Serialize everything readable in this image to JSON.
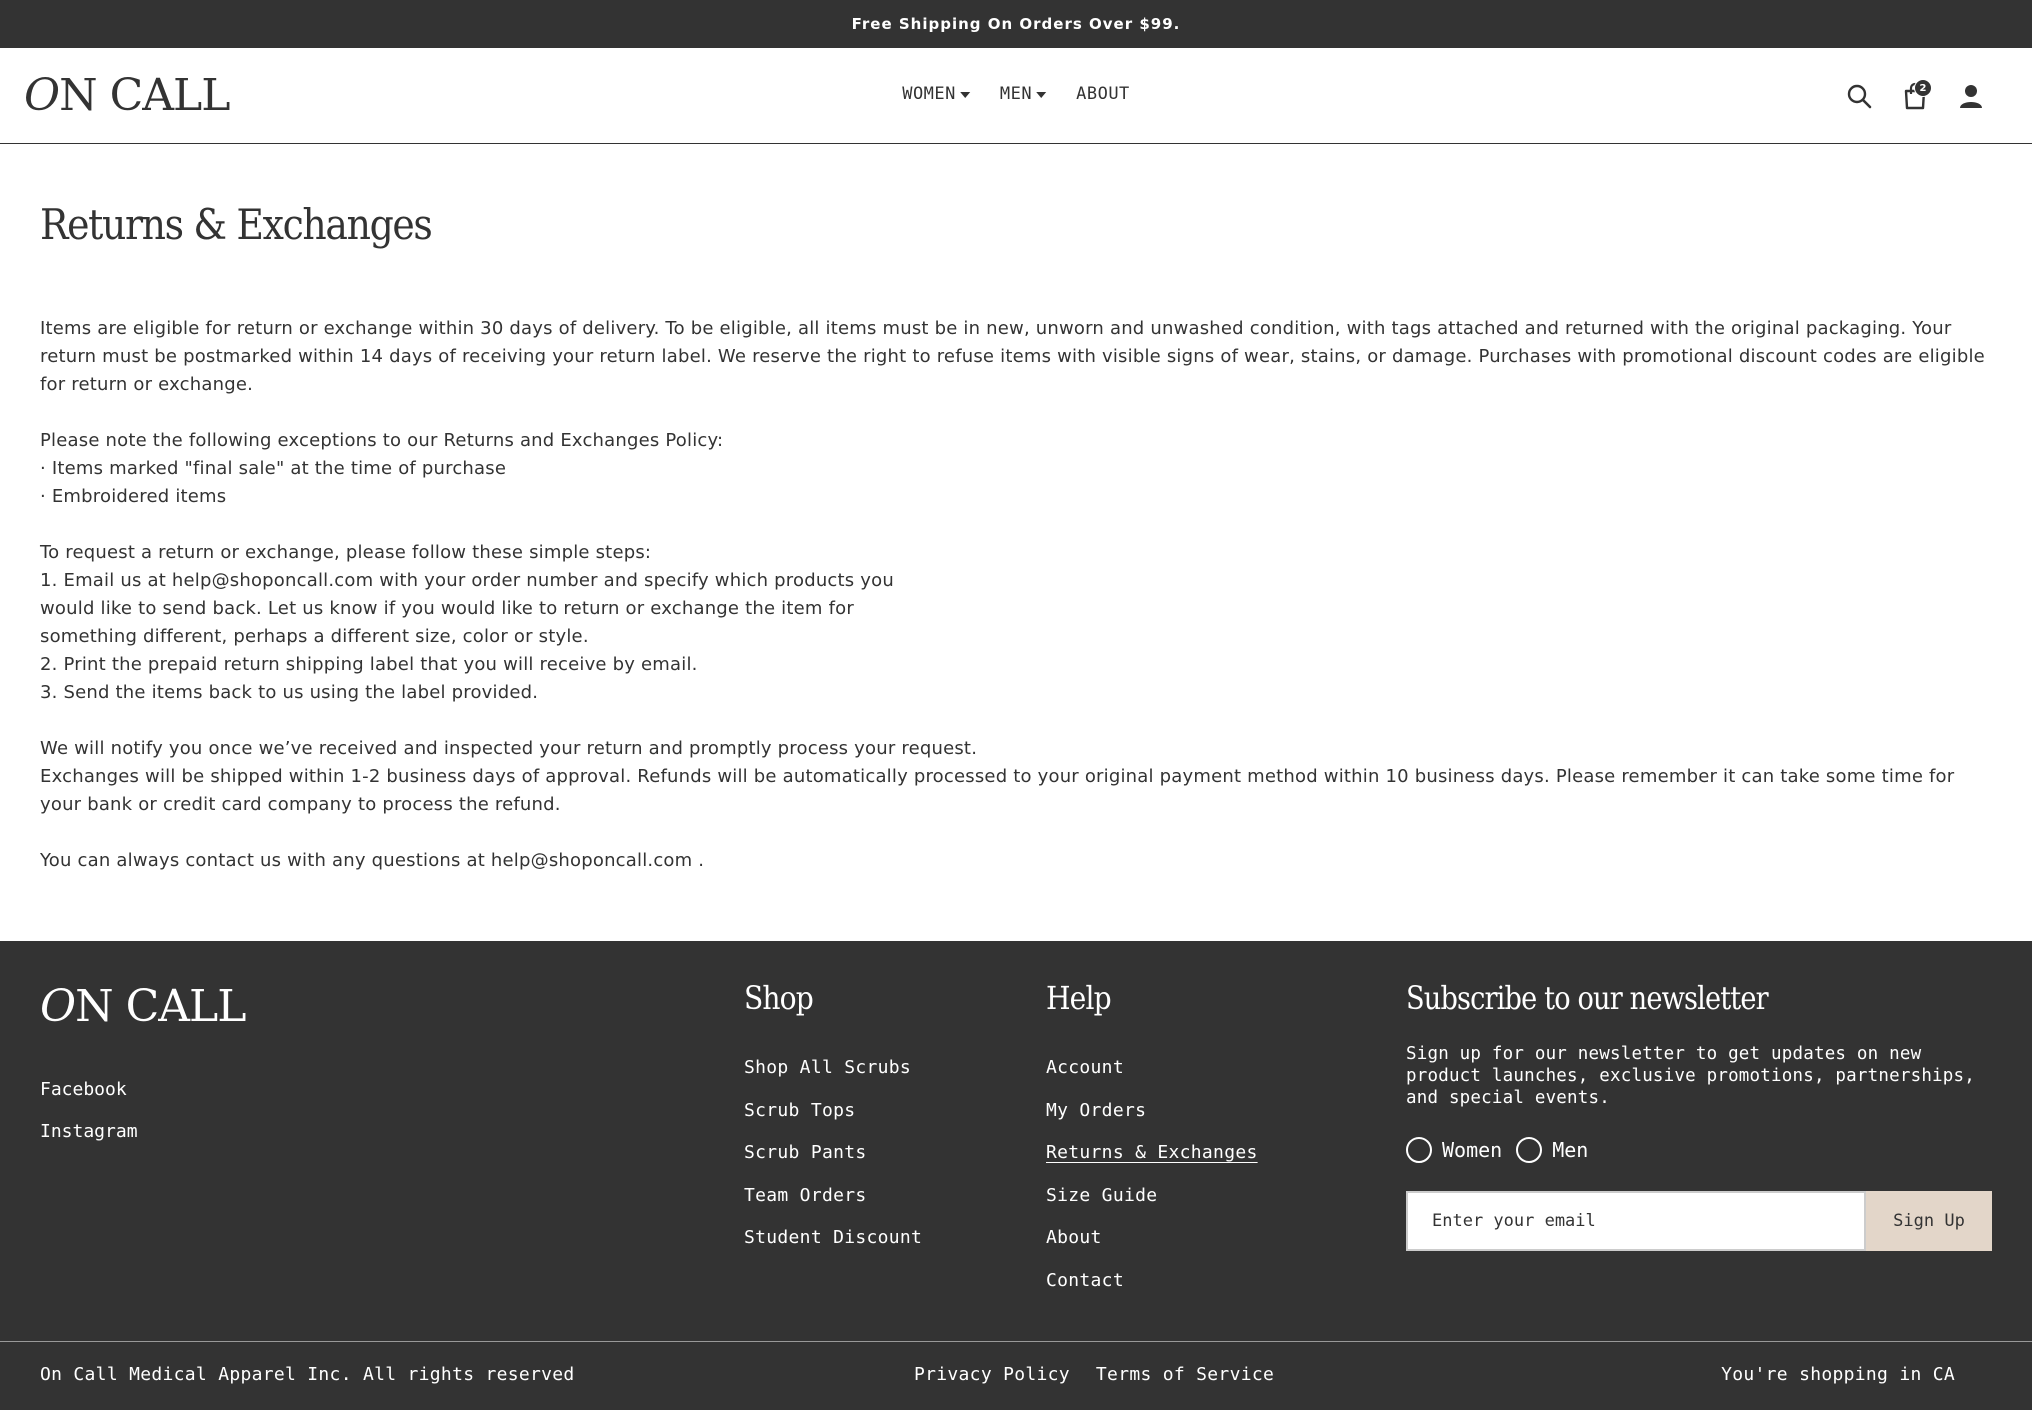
{
  "announcement": "Free Shipping On Orders Over $99.",
  "header": {
    "logo_o": "O",
    "logo_rest": "N CALL",
    "nav": [
      {
        "label": "WOMEN",
        "has_dropdown": true
      },
      {
        "label": "MEN",
        "has_dropdown": true
      },
      {
        "label": "ABOUT",
        "has_dropdown": false
      }
    ],
    "cart_count": "2",
    "icons": [
      "search-icon",
      "cart-icon",
      "account-icon"
    ]
  },
  "page": {
    "title": "Returns & Exchanges",
    "paragraphs": [
      [
        "Items are eligible for return or exchange within 30 days of delivery. To be eligible, all items must be in new, unworn and unwashed condition, with tags attached and returned with the original packaging. Your return must be postmarked within 14 days of receiving your return label. We reserve the right to refuse items with visible signs of wear, stains, or damage. Purchases with promotional discount codes are eligible for return or exchange."
      ],
      [
        "Please note the following exceptions to our Returns and Exchanges Policy:",
        "· Items marked \"final sale\" at the time of purchase",
        "· Embroidered items"
      ],
      [
        "To request a return or exchange, please follow these simple steps:",
        "1. Email us at help@shoponcall.com with your order number and specify which products you",
        "would like to send back. Let us know if you would like to return or exchange the item for",
        "something different, perhaps a different size, color or style.",
        "2. Print the prepaid return shipping label that you will receive by email.",
        "3. Send the items back to us using the label provided."
      ],
      [
        "We will notify you once we’ve received and inspected your return and promptly process your request.",
        "Exchanges will be shipped within 1-2 business days of approval. Refunds will be automatically processed to your original payment method within 10 business days. Please remember it can take some time for your bank or credit card company to process the refund."
      ],
      [
        "You can always contact us with any questions at help@shoponcall.com ."
      ]
    ]
  },
  "footer": {
    "logo_o": "O",
    "logo_rest": "N CALL",
    "social": [
      "Facebook",
      "Instagram"
    ],
    "shop": {
      "heading": "Shop",
      "links": [
        "Shop All Scrubs",
        "Scrub Tops",
        "Scrub Pants",
        "Team Orders",
        "Student Discount"
      ]
    },
    "help": {
      "heading": "Help",
      "links": [
        "Account",
        "My Orders",
        "Returns & Exchanges",
        "Size Guide",
        "About",
        "Contact"
      ],
      "active_index": 2
    },
    "newsletter": {
      "heading": "Subscribe to our newsletter",
      "description": "Sign up for our newsletter to get updates on new product launches, exclusive promotions, partnerships, and special events.",
      "options": [
        "Women",
        "Men"
      ],
      "email_placeholder": "Enter your email",
      "button_label": "Sign Up"
    },
    "copyright": "On Call Medical Apparel Inc. All rights reserved",
    "legal": [
      "Privacy Policy",
      "Terms of Service"
    ],
    "region": "You're shopping in CA"
  },
  "colors": {
    "dark": "#333333",
    "accent_button": "#e3d6c9",
    "white": "#ffffff"
  }
}
